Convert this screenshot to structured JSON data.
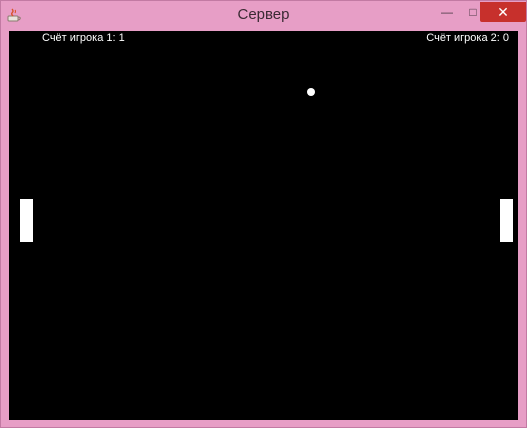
{
  "window": {
    "title": "Сервер",
    "controls": {
      "minimize": "—",
      "maximize": "□",
      "close": "✕"
    },
    "frame_color": "#e79ec6",
    "close_color": "#c7302c"
  },
  "game": {
    "background": "#000000",
    "score_player1": "Счёт игрока 1: 1",
    "score_player2": "Счёт игрока 2: 0"
  }
}
